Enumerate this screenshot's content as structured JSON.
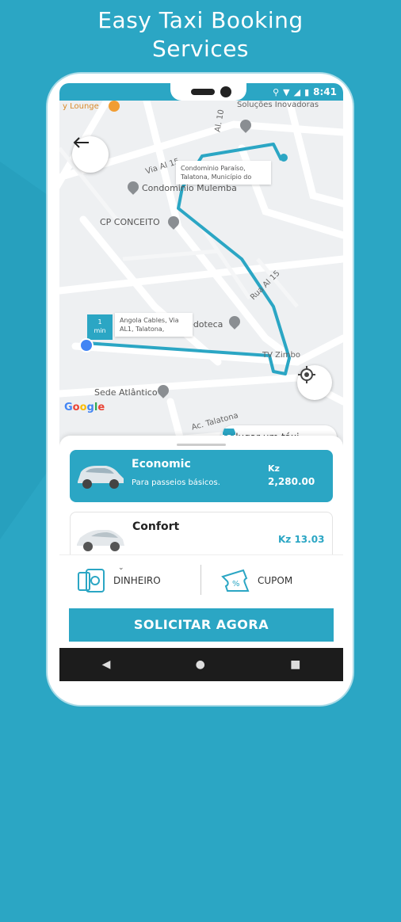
{
  "headline": {
    "line1": "Easy Taxi Booking",
    "line2": "Services"
  },
  "status": {
    "time": "8:41"
  },
  "map": {
    "labels": {
      "lounge": "y Lounge",
      "solucoes": "Soluções Inovadoras",
      "condominio": "Condominio Mulemba",
      "cp_conceito": "CP CONCEITO",
      "brinquedoteca": "Brinquedoteca",
      "atlantico": "Sede Atlântico",
      "tv_zimbo": "TV Zimbo",
      "via_al15": "Via Al 15",
      "rua_al15": "Rua Al 15",
      "al10": "Al. 10",
      "talatona": "Ac. Talatona"
    },
    "dest_callout": [
      "Condominio Paraíso,",
      "Talatona, Município do"
    ],
    "origin_callout": [
      "Angola Cables, Via",
      "AL1, Talatona,"
    ],
    "eta_badge": [
      "1",
      "min"
    ],
    "google": "Google",
    "rent_button": "Alugar um táxi"
  },
  "rides": [
    {
      "name": "Economic",
      "desc": "Para passeios básicos.",
      "currency": "Kz",
      "price": "2,280.00"
    },
    {
      "name": "Confort",
      "price": "Kz 13.03"
    }
  ],
  "payment": {
    "cash": "DINHEIRO",
    "coupon": "CUPOM"
  },
  "cta": "SOLICITAR AGORA",
  "colors": {
    "accent": "#2ba6c4",
    "background": "#2ba6c4"
  },
  "icons": [
    "back-arrow-icon",
    "locate-icon",
    "car-icon",
    "cash-icon",
    "coupon-icon",
    "chevron-down-icon",
    "map-pin-icon",
    "wifi-icon",
    "signal-icon",
    "battery-icon"
  ]
}
